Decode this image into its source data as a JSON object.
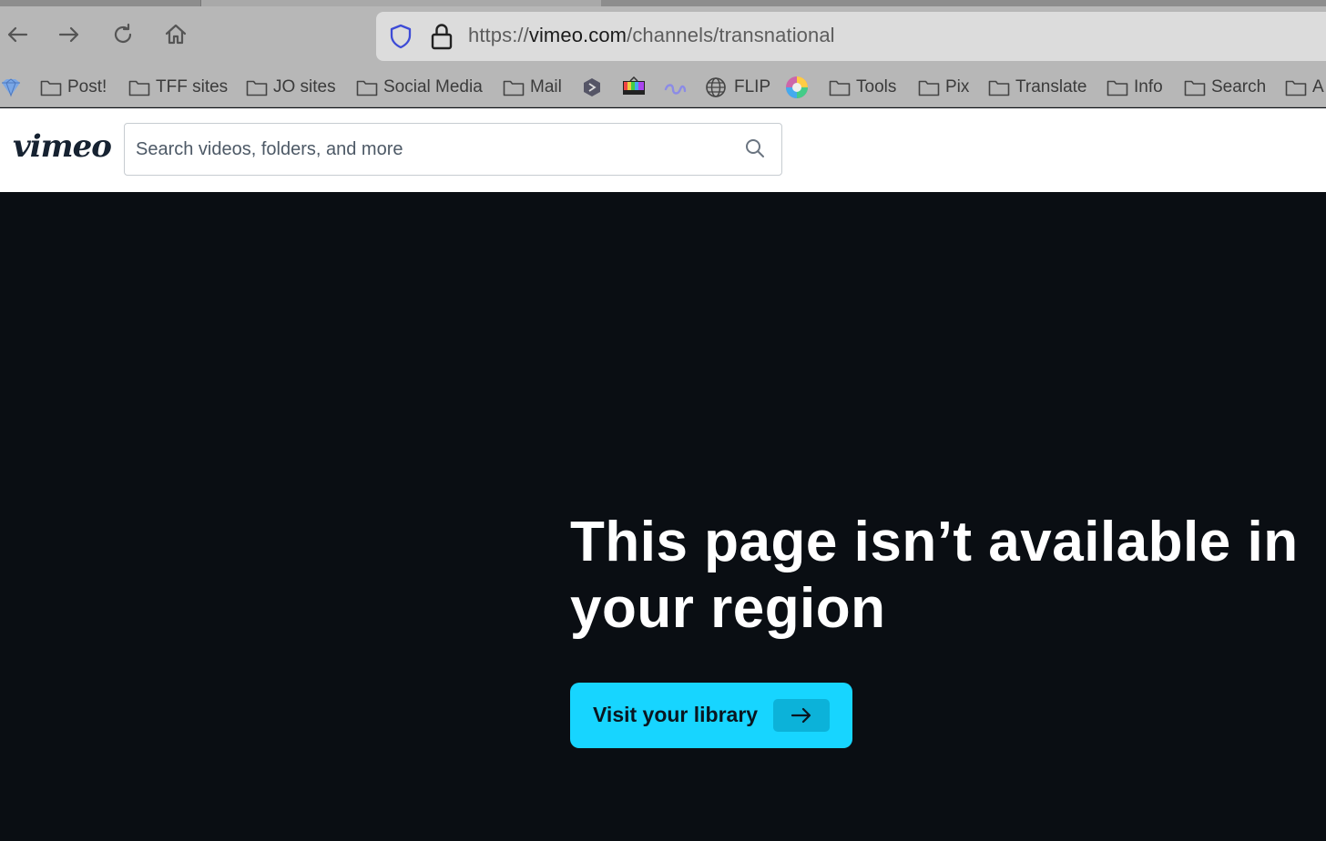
{
  "browser": {
    "url_scheme": "https://",
    "url_host": "vimeo.com",
    "url_path": "/channels/transnational",
    "bookmarks": [
      {
        "label": "Post!",
        "icon": "folder-icon"
      },
      {
        "label": "TFF sites",
        "icon": "folder-icon"
      },
      {
        "label": "JO sites",
        "icon": "folder-icon"
      },
      {
        "label": "Social Media",
        "icon": "folder-icon"
      },
      {
        "label": "Mail",
        "icon": "folder-icon"
      },
      {
        "label": "FLIP",
        "icon": "globe-icon"
      },
      {
        "label": "Tools",
        "icon": "folder-icon"
      },
      {
        "label": "Pix",
        "icon": "folder-icon"
      },
      {
        "label": "Translate",
        "icon": "folder-icon"
      },
      {
        "label": "Info",
        "icon": "folder-icon"
      },
      {
        "label": "Search",
        "icon": "folder-icon"
      },
      {
        "label": "A",
        "icon": "folder-icon"
      }
    ]
  },
  "vimeo": {
    "logo_text": "vimeo",
    "search_placeholder": "Search videos, folders, and more"
  },
  "main": {
    "headline_line1": "This page isn’t available in",
    "headline_line2": "your region",
    "cta_label": "Visit your library"
  },
  "colors": {
    "accent": "#17d5ff",
    "background": "#0a0e13"
  }
}
